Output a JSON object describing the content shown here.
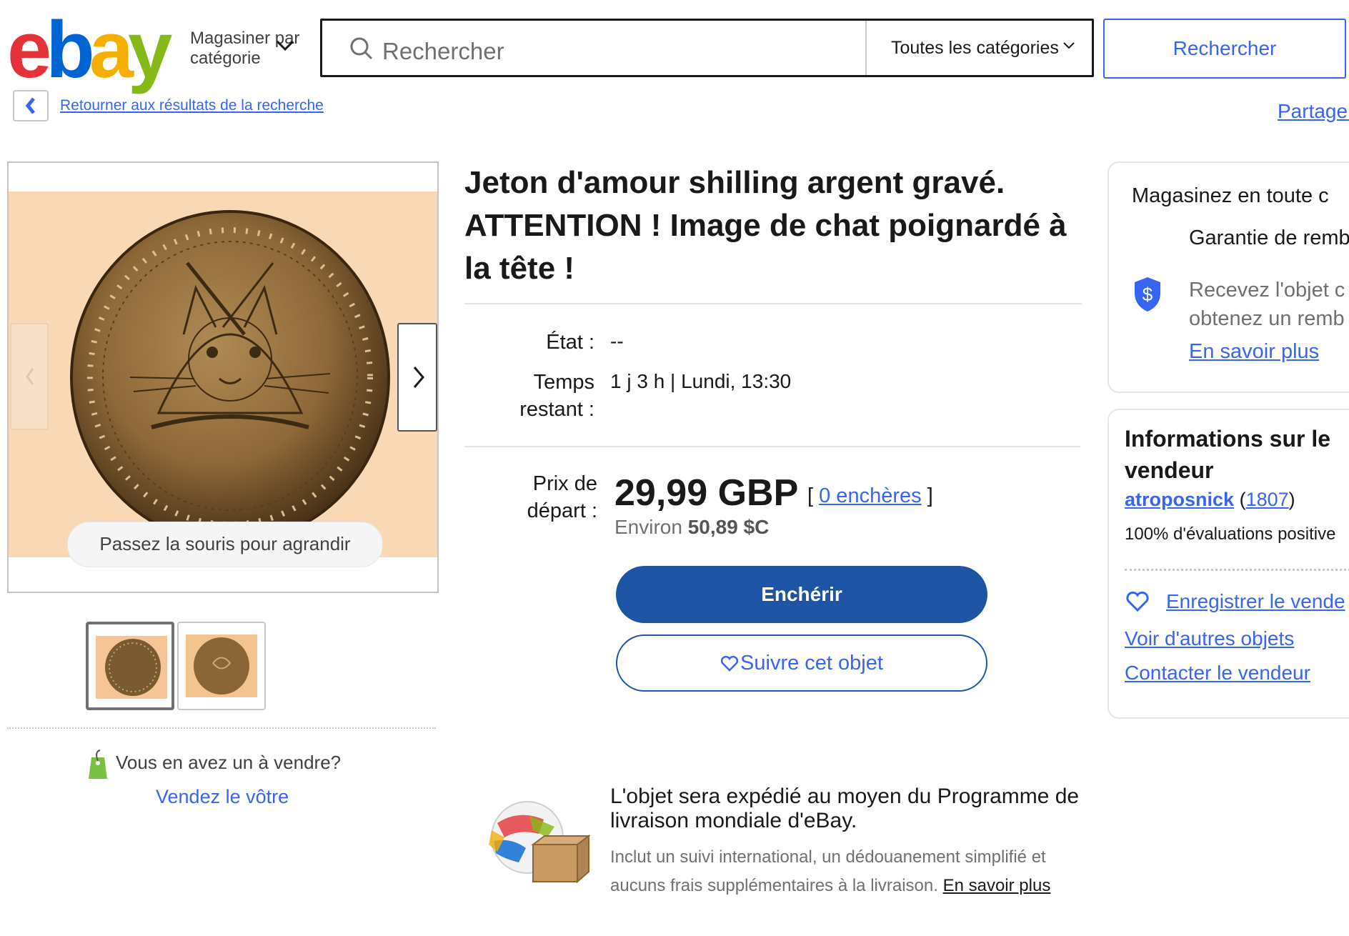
{
  "header": {
    "logo": {
      "e": "e",
      "b": "b",
      "a": "a",
      "y": "y"
    },
    "shop_by_category": "Magasiner par catégorie",
    "search_placeholder": "Rechercher",
    "category_select": "Toutes les catégories",
    "search_button": "Rechercher"
  },
  "nav": {
    "back_link": "Retourner aux résultats de la recherche",
    "share": "Partager"
  },
  "gallery": {
    "hover_hint": "Passez la souris pour agrandir",
    "sell_prompt": "Vous en avez un à vendre?",
    "sell_link": "Vendez le vôtre"
  },
  "item": {
    "title": "Jeton d'amour shilling argent gravé. ATTENTION ! Image de chat poignardé à la tête !",
    "condition_label": "État :",
    "condition_value": "--",
    "time_left_label": "Temps restant :",
    "time_left_value": "1 j 3 h | Lundi, 13:30",
    "start_price_label": "Prix de départ :",
    "price": "29,99 GBP",
    "bids_open": "[",
    "bids_link": "0 enchères",
    "bids_close": "]",
    "approx_prefix": "Environ",
    "approx_value": "50,89 $C",
    "bid_button": "Enchérir",
    "watch_button": "Suivre cet objet"
  },
  "shipping": {
    "title": "L'objet sera expédié au moyen du Programme de livraison mondiale d'eBay.",
    "desc": "Inclut un suivi international, un dédouanement simplifié et aucuns frais supplémentaires à la livraison.",
    "more": "En savoir plus"
  },
  "guarantee_card": {
    "title": "Magasinez en toute c",
    "heading": "Garantie de remb eBay",
    "desc_line1": "Recevez l'objet c",
    "desc_line2": "obtenez un remb",
    "more": "En savoir plus"
  },
  "seller_card": {
    "title": "Informations sur le vendeur",
    "seller_name": "atroposnick",
    "feedback_open": "(",
    "feedback_count": "1807",
    "feedback_close": ")",
    "positive": "100% d'évaluations positive",
    "save_seller": "Enregistrer le vende",
    "other_items": "Voir d'autres objets",
    "contact": "Contacter le vendeur"
  },
  "colors": {
    "accent": "#3665f3",
    "bid_button": "#1e54a4",
    "image_bg": "#f9d8b5"
  }
}
